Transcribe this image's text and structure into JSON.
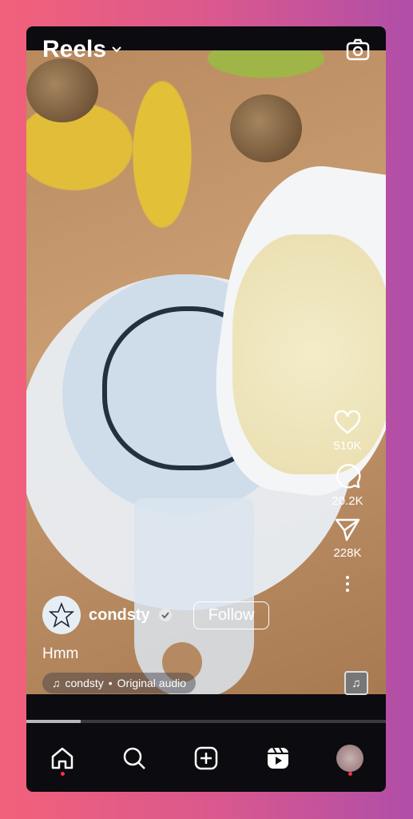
{
  "header": {
    "title": "Reels",
    "dropdown_icon": "chevron-down-icon",
    "camera_icon": "camera-icon"
  },
  "actions": {
    "likes": "510K",
    "comments": "20.2K",
    "shares": "228K"
  },
  "post": {
    "username": "condsty",
    "verified": true,
    "follow_label": "Follow",
    "caption": "Hmm",
    "audio_user": "condsty",
    "audio_separator": "•",
    "audio_title": "Original audio"
  },
  "playback": {
    "progress_percent": 15
  },
  "nav": {
    "items": [
      "home",
      "search",
      "create",
      "reels",
      "profile"
    ]
  },
  "colors": {
    "notification_dot": "#ff3040",
    "background_start": "#f2617a",
    "background_end": "#b04ea8"
  }
}
